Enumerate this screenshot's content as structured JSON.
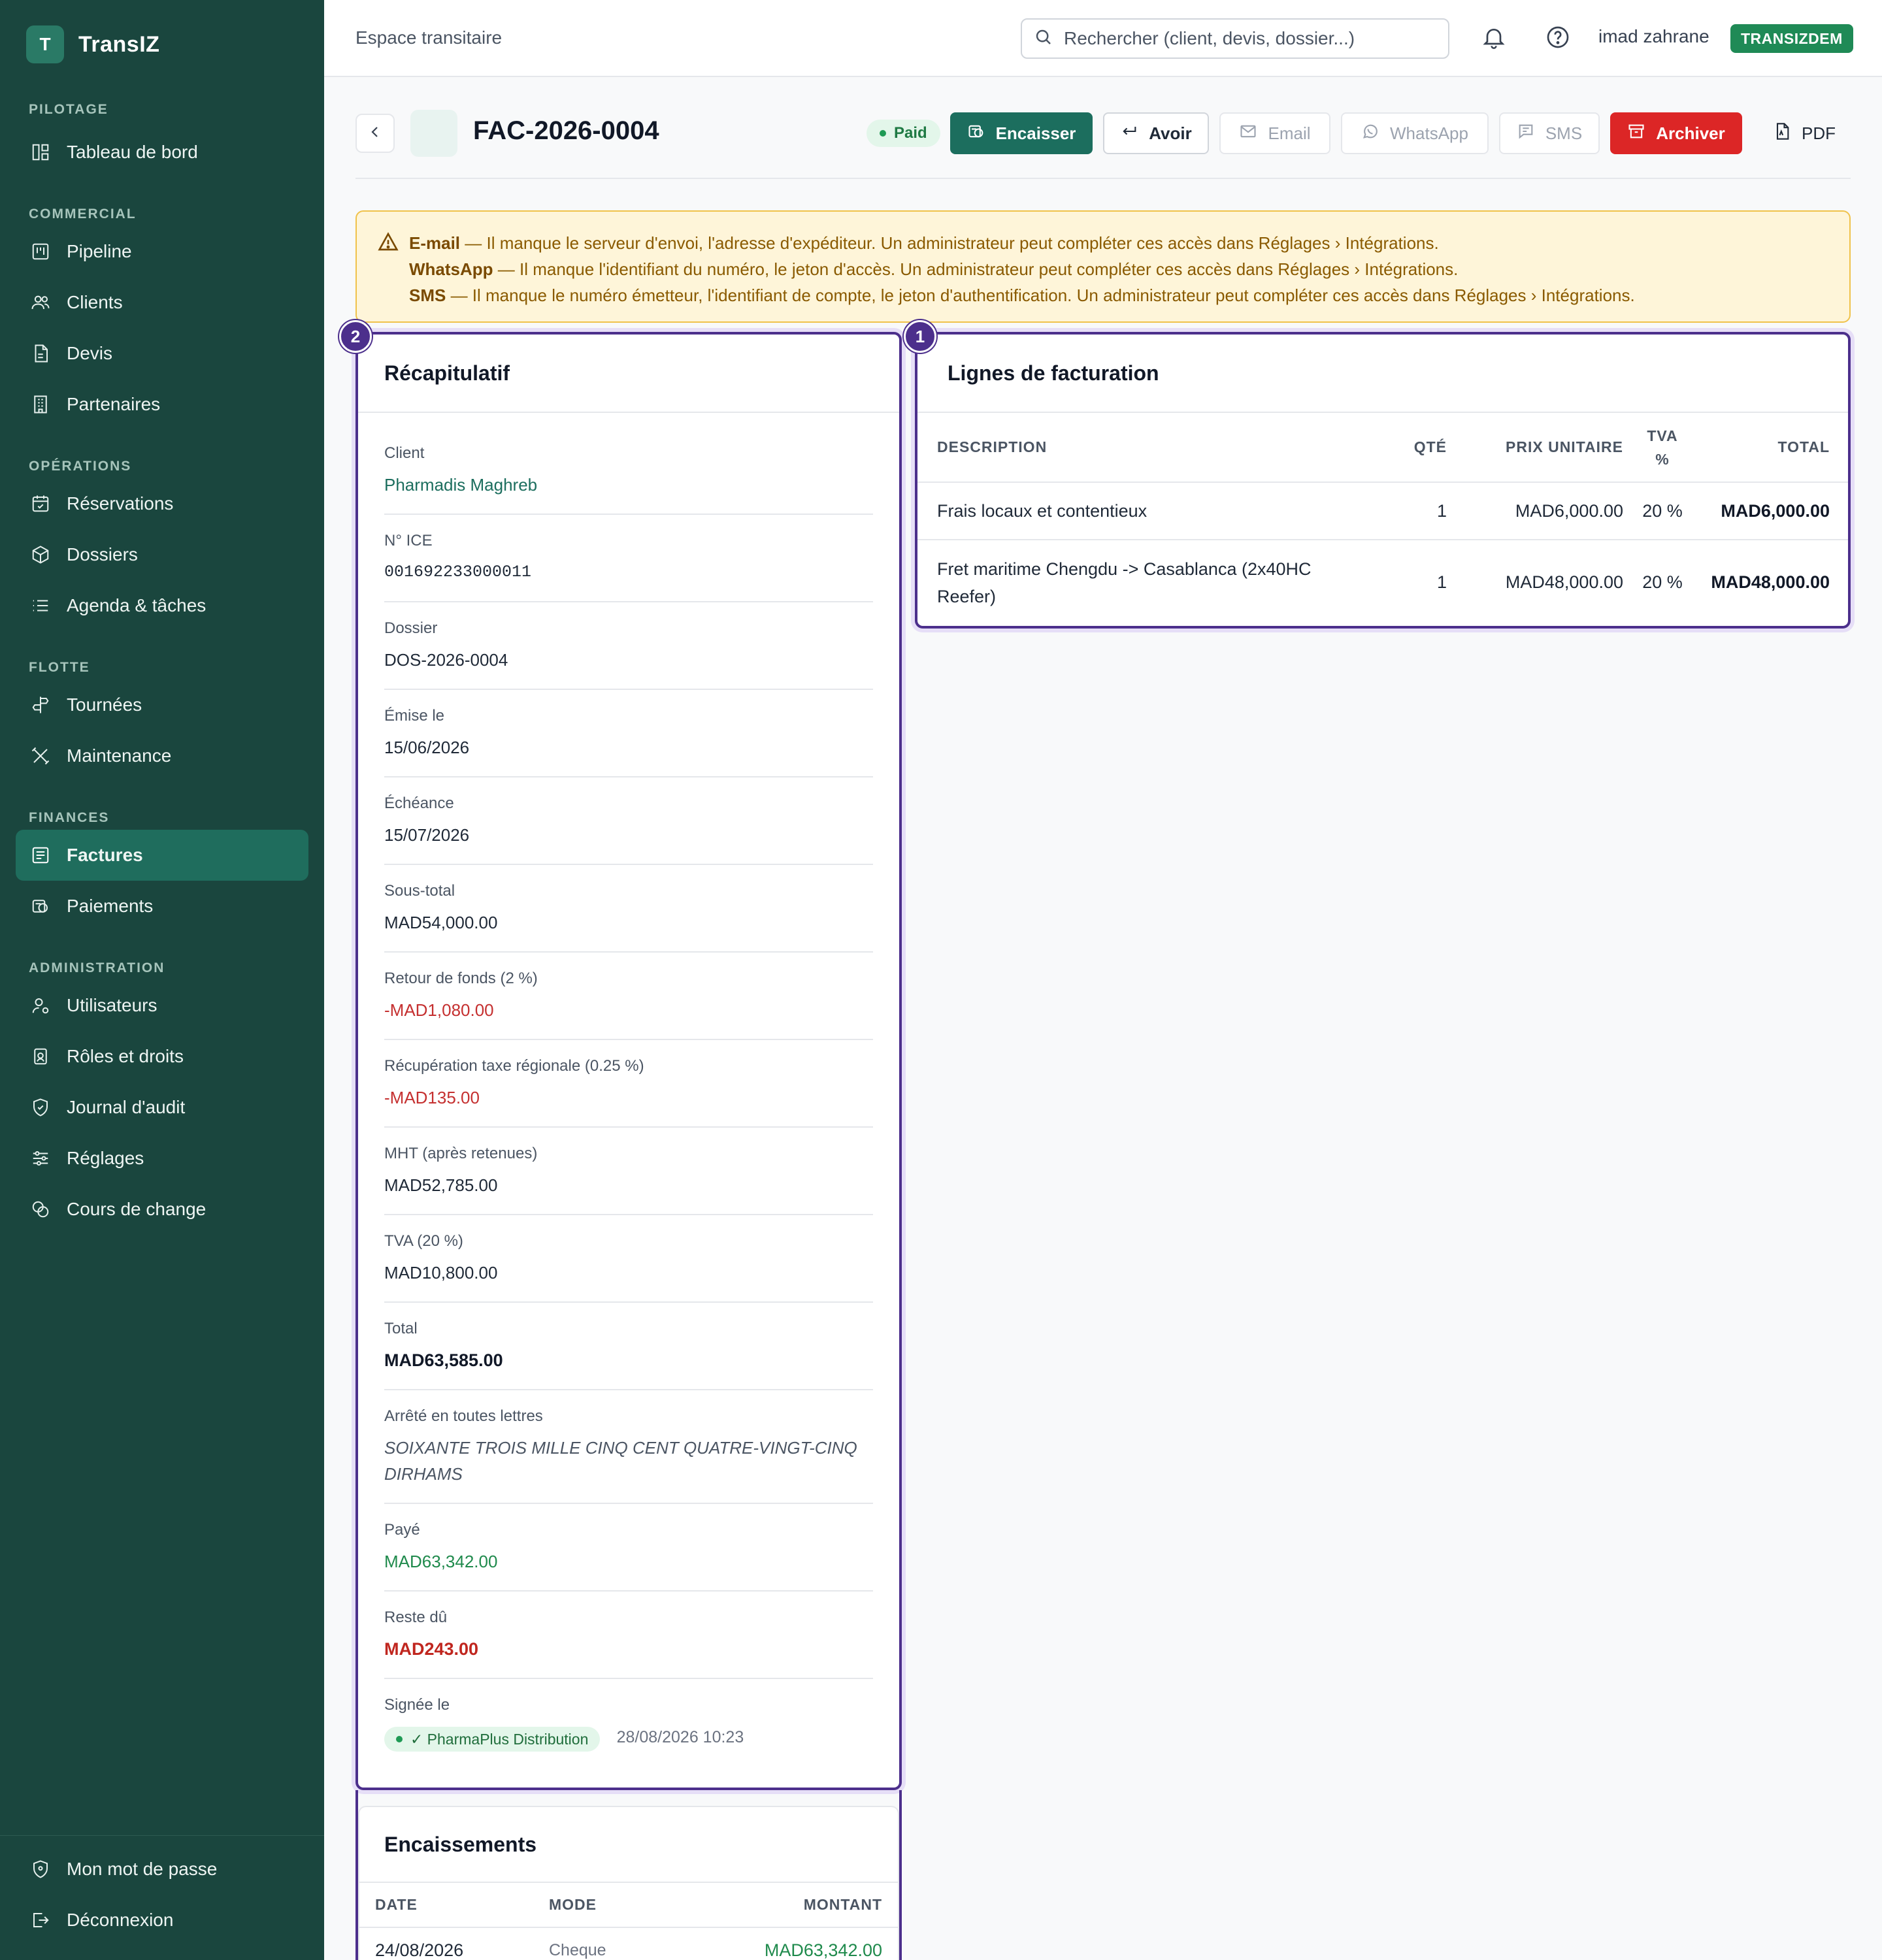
{
  "app": {
    "logo_letter": "T",
    "name": "TransIZ"
  },
  "sidebar": {
    "sections": [
      {
        "title": "PILOTAGE",
        "items": [
          {
            "label": "Tableau de bord",
            "icon": "dashboard-icon"
          }
        ]
      },
      {
        "title": "COMMERCIAL",
        "items": [
          {
            "label": "Pipeline",
            "icon": "kanban-icon"
          },
          {
            "label": "Clients",
            "icon": "users-icon"
          },
          {
            "label": "Devis",
            "icon": "file-icon"
          },
          {
            "label": "Partenaires",
            "icon": "building-icon"
          }
        ]
      },
      {
        "title": "OPÉRATIONS",
        "items": [
          {
            "label": "Réservations",
            "icon": "calendar-check-icon"
          },
          {
            "label": "Dossiers",
            "icon": "box-icon"
          },
          {
            "label": "Agenda & tâches",
            "icon": "list-icon"
          }
        ]
      },
      {
        "title": "FLOTTE",
        "items": [
          {
            "label": "Tournées",
            "icon": "signpost-icon"
          },
          {
            "label": "Maintenance",
            "icon": "wrench-icon"
          }
        ]
      },
      {
        "title": "FINANCES",
        "items": [
          {
            "label": "Factures",
            "icon": "invoice-icon",
            "active": true
          },
          {
            "label": "Paiements",
            "icon": "payment-icon"
          }
        ]
      },
      {
        "title": "ADMINISTRATION",
        "items": [
          {
            "label": "Utilisateurs",
            "icon": "user-cog-icon"
          },
          {
            "label": "Rôles et droits",
            "icon": "badge-icon"
          },
          {
            "label": "Journal d'audit",
            "icon": "shield-icon"
          },
          {
            "label": "Réglages",
            "icon": "sliders-icon"
          },
          {
            "label": "Cours de change",
            "icon": "coins-icon"
          }
        ]
      }
    ],
    "bottom": [
      {
        "label": "Mon mot de passe",
        "icon": "shield-lock-icon"
      },
      {
        "label": "Déconnexion",
        "icon": "logout-icon"
      }
    ]
  },
  "topbar": {
    "title": "Espace transitaire",
    "search_placeholder": "Rechercher (client, devis, dossier...)",
    "user": "imad zahrane",
    "tenant": "TRANSIZDEM"
  },
  "header": {
    "doc_number": "FAC-2026-0004",
    "status": "Paid",
    "actions": {
      "encaisser": "Encaisser",
      "avoir": "Avoir",
      "email": "Email",
      "whatsapp": "WhatsApp",
      "sms": "SMS",
      "archiver": "Archiver",
      "pdf": "PDF"
    }
  },
  "warning": {
    "lines": [
      {
        "channel": "E-mail",
        "text": " — Il manque le serveur d'envoi, l'adresse d'expéditeur. Un administrateur peut compléter ces accès dans Réglages › Intégrations."
      },
      {
        "channel": "WhatsApp",
        "text": " — Il manque l'identifiant du numéro, le jeton d'accès. Un administrateur peut compléter ces accès dans Réglages › Intégrations."
      },
      {
        "channel": "SMS",
        "text": " — Il manque le numéro émetteur, l'identifiant de compte, le jeton d'authentification. Un administrateur peut compléter ces accès dans Réglages › Intégrations."
      }
    ]
  },
  "summary": {
    "badge": "2",
    "title": "Récapitulatif",
    "client_label": "Client",
    "client": "Pharmadis Maghreb",
    "ice_label": "N° ICE",
    "ice": "001692233000011",
    "dossier_label": "Dossier",
    "dossier": "DOS-2026-0004",
    "emise_label": "Émise le",
    "emise": "15/06/2026",
    "echeance_label": "Échéance",
    "echeance": "15/07/2026",
    "sous_total_label": "Sous-total",
    "sous_total": "MAD54,000.00",
    "retour_label": "Retour de fonds (2 %)",
    "retour": "-MAD1,080.00",
    "recup_label": "Récupération taxe régionale (0.25 %)",
    "recup": "-MAD135.00",
    "mht_label": "MHT (après retenues)",
    "mht": "MAD52,785.00",
    "tva_label": "TVA (20 %)",
    "tva": "MAD10,800.00",
    "total_label": "Total",
    "total": "MAD63,585.00",
    "lettres_label": "Arrêté en toutes lettres",
    "lettres": "SOIXANTE TROIS MILLE CINQ CENT QUATRE-VINGT-CINQ DIRHAMS",
    "paye_label": "Payé",
    "paye": "MAD63,342.00",
    "reste_label": "Reste dû",
    "reste": "MAD243.00",
    "signee_label": "Signée le",
    "signee_by": "✓ PharmaPlus Distribution",
    "signee_date": "28/08/2026 10:23"
  },
  "lines": {
    "badge": "1",
    "title": "Lignes de facturation",
    "columns": {
      "description": "DESCRIPTION",
      "qty": "QTÉ",
      "unit_price": "PRIX UNITAIRE",
      "tva_1": "TVA",
      "tva_2": "%",
      "total": "TOTAL"
    },
    "rows": [
      {
        "description": "Frais locaux et contentieux",
        "qty": "1",
        "unit_price": "MAD6,000.00",
        "tva": "20 %",
        "total": "MAD6,000.00"
      },
      {
        "description": "Fret maritime Chengdu -> Casablanca (2x40HC Reefer)",
        "qty": "1",
        "unit_price": "MAD48,000.00",
        "tva": "20 %",
        "total": "MAD48,000.00"
      }
    ]
  },
  "encaissements": {
    "title": "Encaissements",
    "columns": {
      "date": "DATE",
      "mode": "MODE",
      "montant": "MONTANT"
    },
    "rows": [
      {
        "date": "24/08/2026",
        "mode": "Cheque",
        "montant": "MAD63,342.00"
      }
    ]
  }
}
